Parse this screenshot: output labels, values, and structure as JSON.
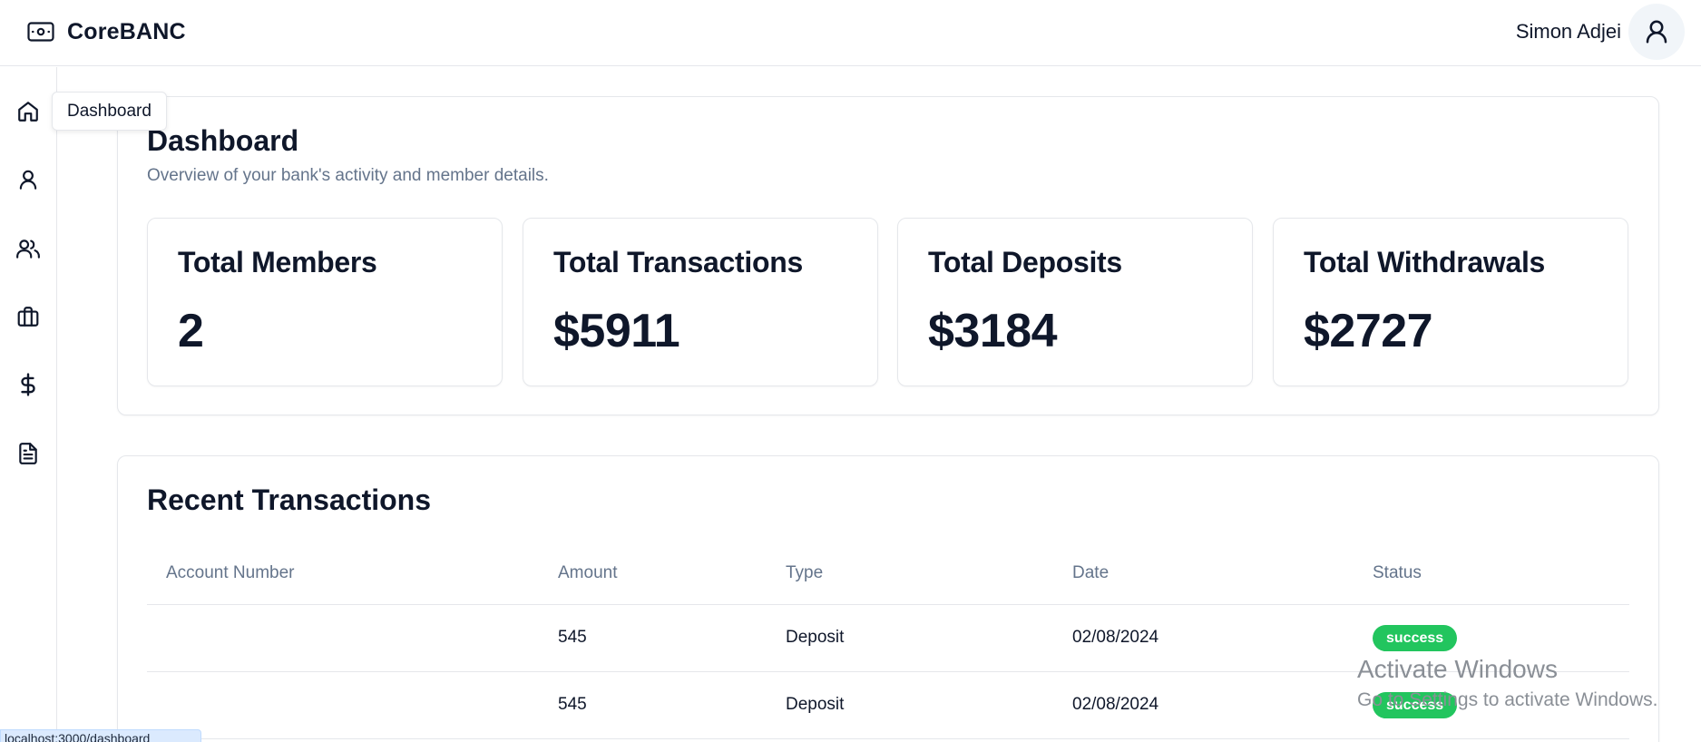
{
  "app": {
    "brand": "CoreBANC",
    "brand_icon": "banknote-icon"
  },
  "user": {
    "name": "Simon Adjei",
    "avatar_icon": "user-icon"
  },
  "sidebar": {
    "items": [
      {
        "icon": "home-icon",
        "label": "Dashboard"
      },
      {
        "icon": "user-icon",
        "label": "Member"
      },
      {
        "icon": "users-icon",
        "label": "Members"
      },
      {
        "icon": "briefcase-icon",
        "label": "Accounts"
      },
      {
        "icon": "dollar-icon",
        "label": "Transactions"
      },
      {
        "icon": "file-text-icon",
        "label": "Reports"
      }
    ],
    "tooltip": "Dashboard"
  },
  "dashboard": {
    "title": "Dashboard",
    "subtitle": "Overview of your bank's activity and member details.",
    "stats": [
      {
        "label": "Total Members",
        "value": "2"
      },
      {
        "label": "Total Transactions",
        "value": "$5911"
      },
      {
        "label": "Total Deposits",
        "value": "$3184"
      },
      {
        "label": "Total Withdrawals",
        "value": "$2727"
      }
    ]
  },
  "transactions": {
    "title": "Recent Transactions",
    "columns": [
      "Account Number",
      "Amount",
      "Type",
      "Date",
      "Status"
    ],
    "rows": [
      {
        "account": "",
        "amount": "545",
        "type": "Deposit",
        "date": "02/08/2024",
        "status": "success"
      },
      {
        "account": "",
        "amount": "545",
        "type": "Deposit",
        "date": "02/08/2024",
        "status": "success"
      }
    ]
  },
  "watermark": {
    "line1": "Activate Windows",
    "line2": "Go to Settings to activate Windows."
  },
  "statusbar": {
    "url": "localhost:3000/dashboard"
  },
  "colors": {
    "success": "#22c55e",
    "muted": "#64748b",
    "text": "#0f172a",
    "border": "#e5e7eb"
  }
}
